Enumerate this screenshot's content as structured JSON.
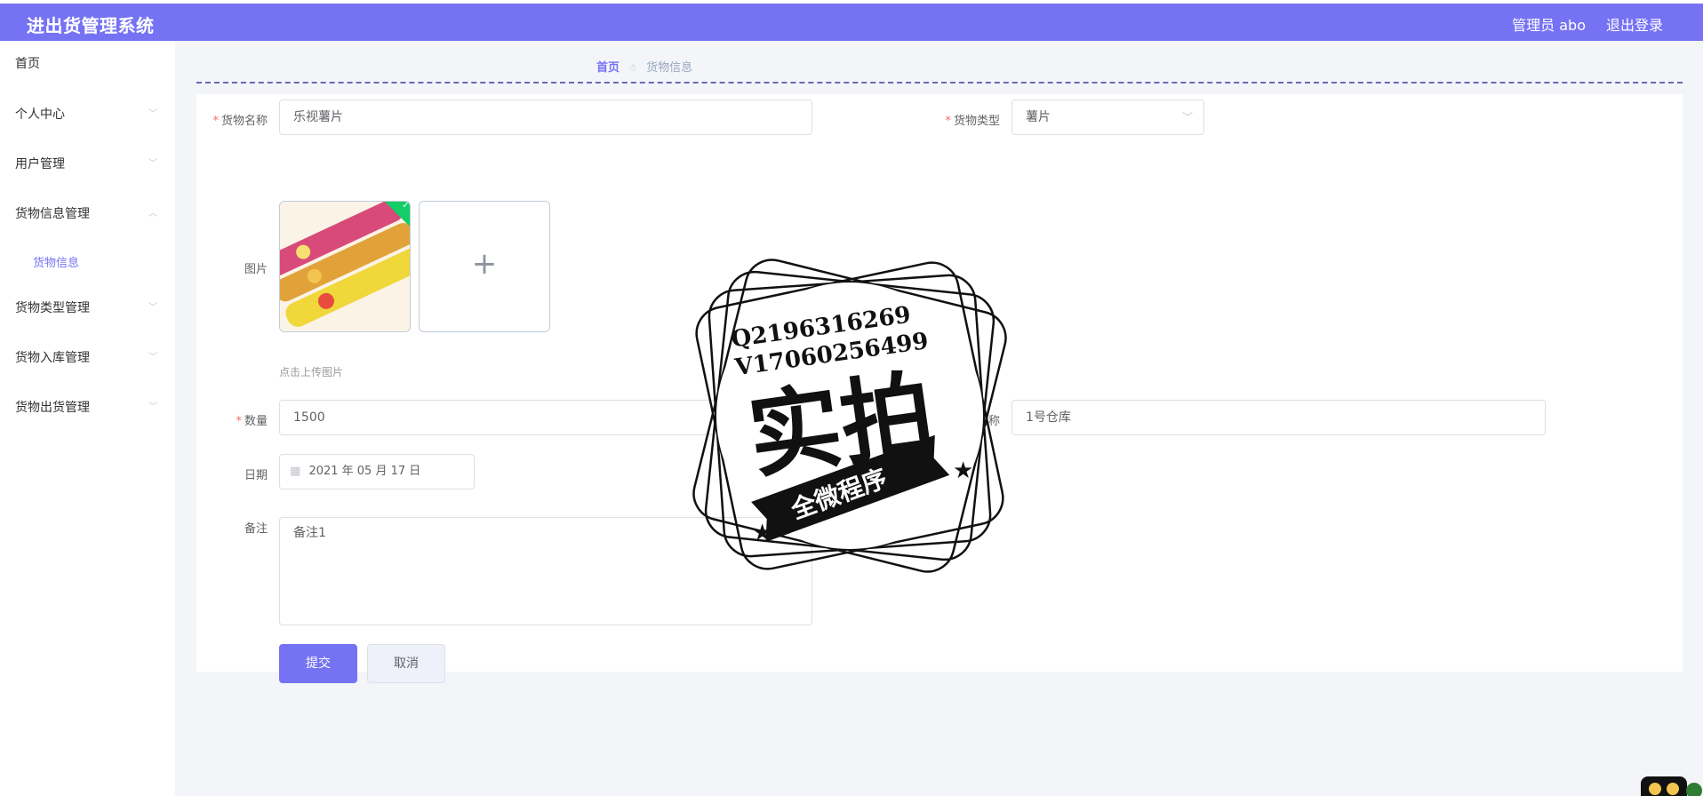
{
  "header": {
    "title": "进出货管理系统",
    "user": "管理员 abo",
    "logout": "退出登录"
  },
  "sidebar": {
    "items": [
      {
        "label": "首页"
      },
      {
        "label": "个人中心"
      },
      {
        "label": "用户管理"
      },
      {
        "label": "货物信息管理"
      },
      {
        "label": "货物类型管理"
      },
      {
        "label": "货物入库管理"
      },
      {
        "label": "货物出货管理"
      }
    ],
    "sub_item": "货物信息"
  },
  "breadcrumb": {
    "home": "首页",
    "current": "货物信息"
  },
  "form": {
    "name_label": "货物名称",
    "name_value": "乐视薯片",
    "type_label": "货物类型",
    "type_value": "薯片",
    "image_label": "图片",
    "upload_hint": "点击上传图片",
    "qty_label": "数量",
    "qty_value": "1500",
    "warehouse_label": "仓库名称",
    "warehouse_value": "1号仓库",
    "date_label": "日期",
    "date_value": "2021 年 05 月 17 日",
    "remark_label": "备注",
    "remark_value": "备注1",
    "submit": "提交",
    "cancel": "取消"
  },
  "watermark": {
    "line1": "Q2196316269",
    "line2": "V17060256499",
    "main": "实拍",
    "ribbon": "全微程序"
  },
  "colors": {
    "accent": "#7572f4",
    "required": "#f56c6c",
    "success": "#13ce66"
  }
}
